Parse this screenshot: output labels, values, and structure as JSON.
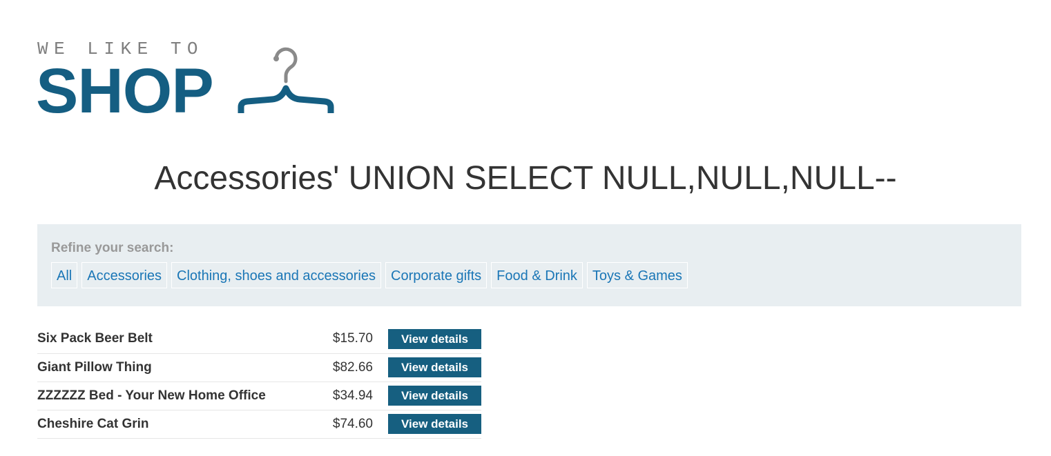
{
  "logo": {
    "tagline": "WE LIKE TO",
    "word": "SHOP",
    "hanger_icon": "hanger-icon",
    "brand_color": "#155e82",
    "hanger_color": "#8a8a8a"
  },
  "page_title": "Accessories' UNION SELECT NULL,NULL,NULL--",
  "filter": {
    "heading": "Refine your search:",
    "links": [
      {
        "label": "All"
      },
      {
        "label": "Accessories"
      },
      {
        "label": "Clothing, shoes and accessories"
      },
      {
        "label": "Corporate gifts"
      },
      {
        "label": "Food & Drink"
      },
      {
        "label": "Toys & Games"
      }
    ],
    "link_color": "#1a76b6",
    "panel_color": "#e8eef1"
  },
  "products": [
    {
      "name": "Six Pack Beer Belt",
      "price": "$15.70",
      "button": "View details"
    },
    {
      "name": "Giant Pillow Thing",
      "price": "$82.66",
      "button": "View details"
    },
    {
      "name": "ZZZZZZ Bed - Your New Home Office",
      "price": "$34.94",
      "button": "View details"
    },
    {
      "name": "Cheshire Cat Grin",
      "price": "$74.60",
      "button": "View details"
    }
  ],
  "button_color": "#165f80"
}
